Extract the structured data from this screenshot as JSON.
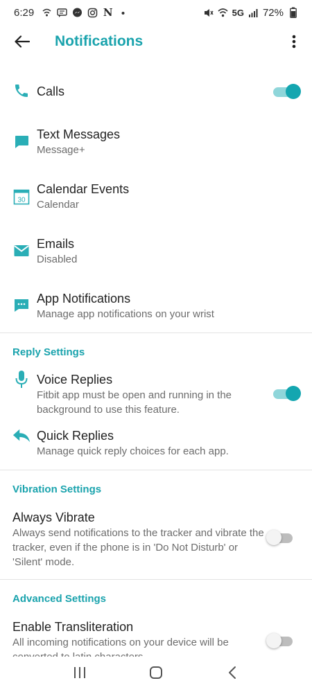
{
  "status_bar": {
    "time": "6:29",
    "network": "5G",
    "battery": "72%",
    "left_icons": [
      "wifi-calling-icon",
      "message-icon",
      "messenger-icon",
      "instagram-icon",
      "n-app-icon",
      "dot-icon"
    ],
    "n_glyph": "N",
    "right_icons": [
      "mute-icon",
      "wifi-icon",
      "signal-icon",
      "battery-icon"
    ]
  },
  "header": {
    "title": "Notifications",
    "accent_color": "#1aa3ad"
  },
  "items": [
    {
      "title": "Calls",
      "subtitle": "",
      "icon": "phone-icon",
      "toggle": true
    },
    {
      "title": "Text Messages",
      "subtitle": "Message+",
      "icon": "chat-bubble-icon"
    },
    {
      "title": "Calendar Events",
      "subtitle": "Calendar",
      "icon": "calendar-icon",
      "icon_text": "30"
    },
    {
      "title": "Emails",
      "subtitle": "Disabled",
      "icon": "mail-icon"
    },
    {
      "title": "App Notifications",
      "subtitle": "Manage app notifications on your wrist",
      "icon": "app-notification-icon"
    }
  ],
  "reply_settings": {
    "header": "Reply Settings",
    "voice": {
      "title": "Voice Replies",
      "subtitle": "Fitbit app must be open and running in the background to use this feature.",
      "icon": "microphone-icon",
      "toggle": true
    },
    "quick": {
      "title": "Quick Replies",
      "subtitle": "Manage quick reply choices for each app.",
      "icon": "reply-icon"
    }
  },
  "vibration_settings": {
    "header": "Vibration Settings",
    "always": {
      "title": "Always Vibrate",
      "subtitle": "Always send notifications to the tracker and vibrate the tracker, even if the phone is in 'Do Not Disturb' or 'Silent' mode.",
      "toggle": false
    }
  },
  "advanced_settings": {
    "header": "Advanced Settings",
    "transliteration": {
      "title": "Enable Transliteration",
      "subtitle": "All incoming notifications on your device will be converted to latin characters.",
      "toggle": false
    }
  },
  "nav_bar": {
    "buttons": [
      "recent-apps-icon",
      "home-icon",
      "back-nav-icon"
    ]
  }
}
